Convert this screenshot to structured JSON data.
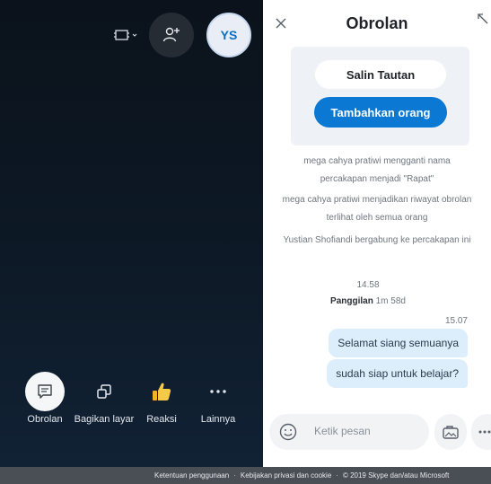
{
  "call": {
    "avatar_initials": "YS",
    "controls": [
      {
        "label": "Obrolan",
        "icon": "chat-icon"
      },
      {
        "label": "Bagikan layar",
        "icon": "share-screen-icon"
      },
      {
        "label": "Reaksi",
        "icon": "thumbs-up-icon"
      },
      {
        "label": "Lainnya",
        "icon": "more-dots-icon"
      }
    ],
    "top_icons": [
      "layout-icon",
      "add-person-icon"
    ]
  },
  "chat": {
    "title": "Obrolan",
    "copy_link_label": "Salin Tautan",
    "add_people_label": "Tambahkan orang",
    "system_messages": [
      "mega cahya pratiwi mengganti nama percakapan menjadi \"Rapat\"",
      "mega cahya pratiwi menjadikan riwayat obrolan terlihat oleh semua orang",
      "Yustian Shofiandi bergabung ke percakapan ini"
    ],
    "time_1": "14.58",
    "call_label": "Panggilan",
    "call_duration": "1m 58d",
    "time_2": "15.07",
    "messages": [
      "Selamat siang semuanya",
      "sudah siap untuk belajar?"
    ],
    "input_placeholder": "Ketik pesan"
  },
  "footer": {
    "terms": "Ketentuan penggunaan",
    "privacy": "Kebijakan privasi dan cookie",
    "copyright": "© 2019 Skype dan/atau Microsoft"
  },
  "colors": {
    "accent": "#0b78d4",
    "bubble": "#dceefc",
    "stage_bg": "#0d1926"
  }
}
